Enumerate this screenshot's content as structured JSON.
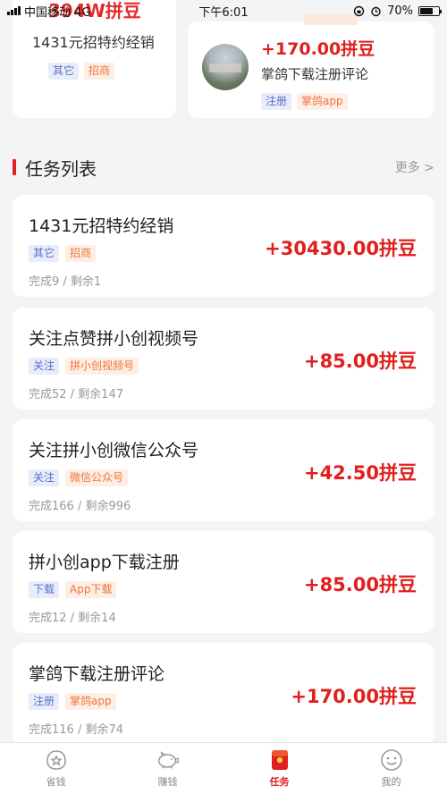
{
  "status_bar": {
    "carrier": "中国移动 4G",
    "time": "下午6:01",
    "battery": "70%",
    "battery_level": 0.7
  },
  "overlay_text": "394W拼豆",
  "top_cards": {
    "left": {
      "title": "1431元招特约经销",
      "tags": [
        "其它",
        "招商"
      ]
    },
    "right": {
      "price": "+170.00拼豆",
      "title": "掌鸽下载注册评论",
      "tags": [
        "注册",
        "掌鸽app"
      ]
    }
  },
  "section": {
    "title": "任务列表",
    "more": "更多 >"
  },
  "tasks": [
    {
      "name": "1431元招特约经销",
      "tags": [
        "其它",
        "招商"
      ],
      "progress": "完成9 / 剩余1",
      "reward": "+30430.00拼豆"
    },
    {
      "name": "关注点赞拼小创视频号",
      "tags": [
        "关注",
        "拼小创视频号"
      ],
      "progress": "完成52 / 剩余147",
      "reward": "+85.00拼豆"
    },
    {
      "name": "关注拼小创微信公众号",
      "tags": [
        "关注",
        "微信公众号"
      ],
      "progress": "完成166 / 剩余996",
      "reward": "+42.50拼豆"
    },
    {
      "name": "拼小创app下载注册",
      "tags": [
        "下载",
        "App下载"
      ],
      "progress": "完成12 / 剩余14",
      "reward": "+85.00拼豆"
    },
    {
      "name": "掌鸽下载注册评论",
      "tags": [
        "注册",
        "掌鸽app"
      ],
      "progress": "完成116 / 剩余74",
      "reward": "+170.00拼豆"
    }
  ],
  "nav": [
    {
      "label": "省钱",
      "icon": "savings-icon",
      "active": false
    },
    {
      "label": "赚钱",
      "icon": "piggy-bank-icon",
      "active": false
    },
    {
      "label": "任务",
      "icon": "task-bag-icon",
      "active": true
    },
    {
      "label": "我的",
      "icon": "smiley-profile-icon",
      "active": false
    }
  ],
  "colors": {
    "accent": "#e0201f",
    "tag_blue_bg": "#e9edfb",
    "tag_blue_text": "#5a6fc7",
    "tag_orange_bg": "#fdeee6",
    "tag_orange_text": "#f0753a"
  }
}
